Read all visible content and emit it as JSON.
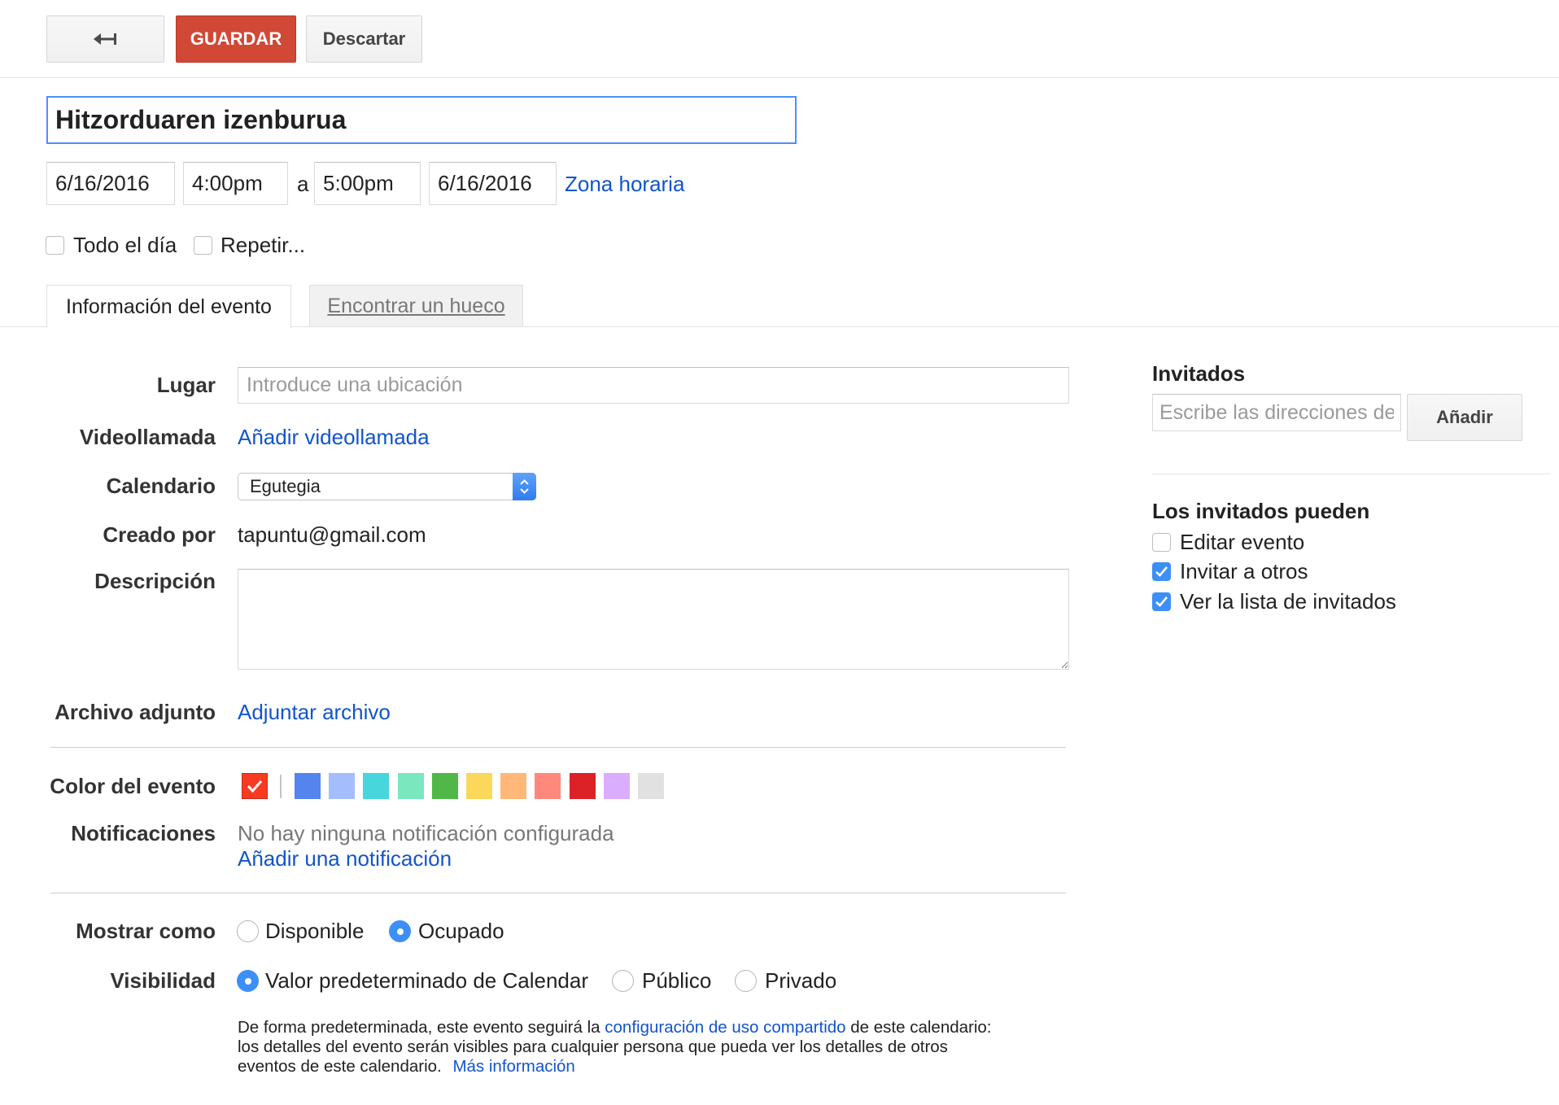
{
  "theme": {
    "save_color": "#d14836",
    "link_color": "#1155cc",
    "focus_color": "#4d90fe",
    "check_color": "#3d8ff5"
  },
  "icons": {
    "back": "back-arrow-icon",
    "calendar_stepper": "select-stepper-icon",
    "check": "checkmark-icon"
  },
  "toolbar": {
    "save_label": "GUARDAR",
    "discard_label": "Descartar"
  },
  "event": {
    "title": "Hitzorduaren izenburua",
    "start_date": "6/16/2016",
    "start_time": "4:00pm",
    "to_label": "a",
    "end_time": "5:00pm",
    "end_date": "6/16/2016",
    "timezone_link": "Zona horaria",
    "all_day_label": "Todo el día",
    "all_day_checked": false,
    "repeat_label": "Repetir...",
    "repeat_checked": false
  },
  "tabs": [
    {
      "label": "Información del evento",
      "active": true
    },
    {
      "label": "Encontrar un hueco",
      "active": false
    }
  ],
  "details": {
    "location": {
      "label": "Lugar",
      "placeholder": "Introduce una ubicación",
      "value": ""
    },
    "video": {
      "label": "Videollamada",
      "link": "Añadir videollamada"
    },
    "calendar": {
      "label": "Calendario",
      "selected": "Egutegia"
    },
    "created_by": {
      "label": "Creado por",
      "value": "tapuntu@gmail.com"
    },
    "description": {
      "label": "Descripción",
      "value": ""
    },
    "attachment": {
      "label": "Archivo adjunto",
      "link": "Adjuntar archivo"
    },
    "event_color": {
      "label": "Color del evento",
      "current": "#f83a22",
      "palette": [
        "#5484ed",
        "#a4bdfc",
        "#46d6db",
        "#7ae7bf",
        "#51b749",
        "#fbd75b",
        "#ffb878",
        "#ff887c",
        "#dc2127",
        "#dbadff",
        "#e1e1e1"
      ]
    },
    "notifications": {
      "label": "Notificaciones",
      "empty_text": "No hay ninguna notificación configurada",
      "add_link": "Añadir una notificación"
    },
    "show_as": {
      "label": "Mostrar como",
      "options": [
        {
          "label": "Disponible",
          "checked": false
        },
        {
          "label": "Ocupado",
          "checked": true
        }
      ]
    },
    "visibility": {
      "label": "Visibilidad",
      "options": [
        {
          "label": "Valor predeterminado de Calendar",
          "checked": true
        },
        {
          "label": "Público",
          "checked": false
        },
        {
          "label": "Privado",
          "checked": false
        }
      ],
      "note": {
        "line1_before": "De forma predeterminada, este evento seguirá la",
        "line1_link": "configuración de uso compartido",
        "line1_after": "de este calendario:",
        "line2": "los detalles del evento serán visibles para cualquier persona que pueda ver los detalles de otros",
        "line3": "eventos de este calendario.",
        "more_link": "Más información"
      }
    }
  },
  "guests": {
    "title": "Invitados",
    "input_placeholder": "Escribe las direcciones de",
    "add_label": "Añadir",
    "permissions_title": "Los invitados pueden",
    "permissions": [
      {
        "label": "Editar evento",
        "checked": false
      },
      {
        "label": "Invitar a otros",
        "checked": true
      },
      {
        "label": "Ver la lista de invitados",
        "checked": true
      }
    ]
  }
}
